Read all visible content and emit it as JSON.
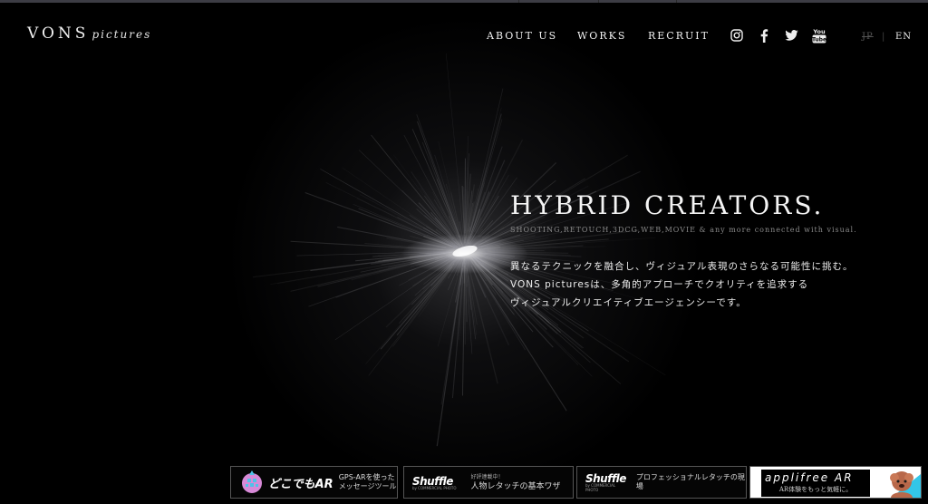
{
  "brand": {
    "name": "VONS",
    "suffix": "pictures"
  },
  "nav": {
    "items": [
      "ABOUT US",
      "WORKS",
      "RECRUIT"
    ],
    "social": [
      "instagram-icon",
      "facebook-icon",
      "twitter-icon",
      "youtube-icon"
    ],
    "youtube_text": "You Tube",
    "lang": {
      "jp": "JP",
      "separator": "|",
      "en": "EN",
      "active": "EN"
    }
  },
  "hero": {
    "title": "HYBRID CREATORS.",
    "subtitle": "SHOOTING,RETOUCH,3DCG,WEB,MOVIE & any more connected with visual.",
    "lines": [
      "異なるテクニックを融合し、ヴィジュアル表現のさらなる可能性に挑む。",
      "VONS picturesは、多角的アプローチでクオリティを追求する",
      "ヴィジュアルクリエイティブエージェンシーです。"
    ]
  },
  "banners": [
    {
      "logo": "どこでもAR",
      "line1": "GPS-ARを使った",
      "line2": "メッセージツール"
    },
    {
      "logo": "Shuffle",
      "tag": "by COMMERCIAL PHOTO",
      "line1": "好評連載中！",
      "line2": "人物レタッチの基本ワザ"
    },
    {
      "logo": "Shuffle",
      "tag": "by COMMERCIAL PHOTO",
      "line1": "プロフェッショナルレタッチの現場"
    },
    {
      "logo": "applifree AR",
      "line1": "AR体験をもっと気軽に。"
    }
  ],
  "colors": {
    "background": "#000000",
    "text": "#ffffff",
    "muted": "#8a8a8a",
    "banner_border": "#555555",
    "accent_cyan": "#33c6e8"
  }
}
